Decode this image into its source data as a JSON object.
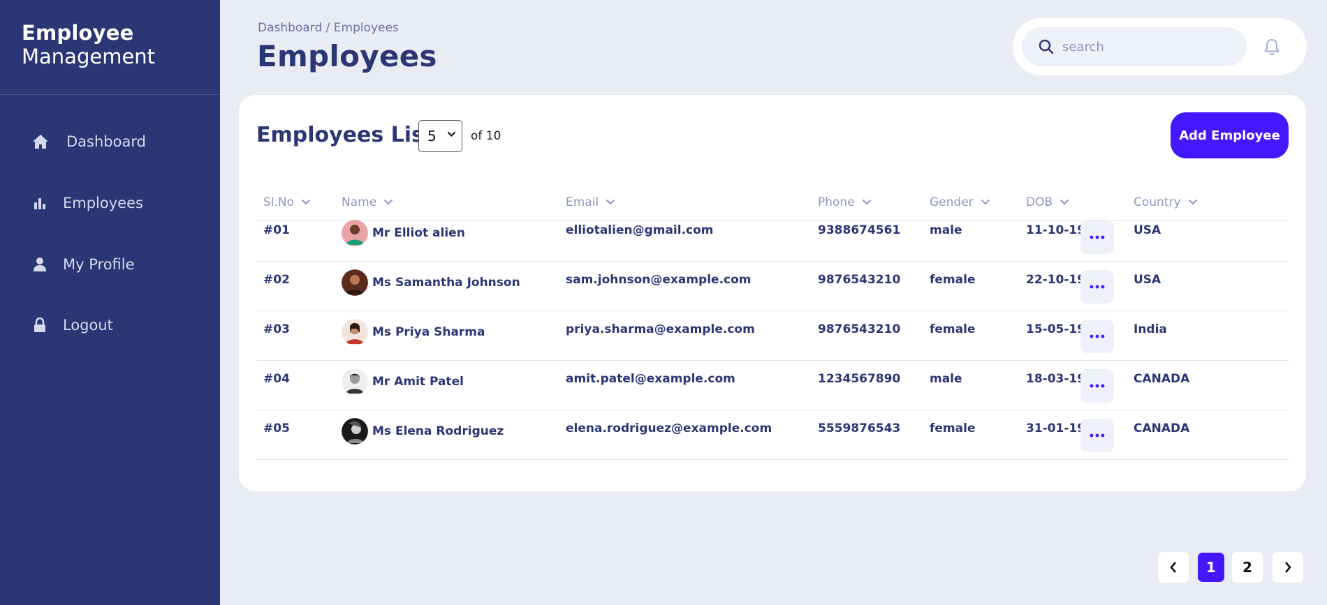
{
  "brand": {
    "line1": "Employee",
    "line2": "Management"
  },
  "sidebar": {
    "items": [
      {
        "label": "Dashboard",
        "icon": "home-icon"
      },
      {
        "label": "Employees",
        "icon": "bar-chart-icon"
      },
      {
        "label": "My Profile",
        "icon": "user-icon"
      },
      {
        "label": "Logout",
        "icon": "lock-icon"
      }
    ]
  },
  "header": {
    "breadcrumb": "Dashboard / Employees",
    "title": "Employees",
    "search_placeholder": "search",
    "bell_icon": "bell-icon"
  },
  "card": {
    "title": "Employees List",
    "per_page": "5",
    "of_total": "of 10",
    "add_label": "Add Employee"
  },
  "table": {
    "headers": [
      "Sl.No",
      "Name",
      "Email",
      "Phone",
      "Gender",
      "DOB",
      "Country"
    ],
    "rows": [
      {
        "id": "#01",
        "name": "Mr Elliot alien",
        "email": "elliotalien@gmail.com",
        "phone": "9388674561",
        "gender": "male",
        "dob": "11-10-1995",
        "country": "USA"
      },
      {
        "id": "#02",
        "name": "Ms Samantha Johnson",
        "email": "sam.johnson@example.com",
        "phone": "9876543210",
        "gender": "female",
        "dob": "22-10-1991",
        "country": "USA"
      },
      {
        "id": "#03",
        "name": "Ms Priya Sharma",
        "email": "priya.sharma@example.com",
        "phone": "9876543210",
        "gender": "female",
        "dob": "15-05-1990",
        "country": "India"
      },
      {
        "id": "#04",
        "name": "Mr Amit Patel",
        "email": "amit.patel@example.com",
        "phone": "1234567890",
        "gender": "male",
        "dob": "18-03-1992",
        "country": "CANADA"
      },
      {
        "id": "#05",
        "name": "Ms Elena Rodriguez",
        "email": "elena.rodriguez@example.com",
        "phone": "5559876543",
        "gender": "female",
        "dob": "31-01-1989",
        "country": "CANADA"
      }
    ]
  },
  "pagination": {
    "pages": [
      "1",
      "2"
    ],
    "current": "1"
  },
  "colors": {
    "sidebar": "#2b3674",
    "accent": "#4318ff",
    "background": "#e9ecf2",
    "text": "#2b3674"
  }
}
